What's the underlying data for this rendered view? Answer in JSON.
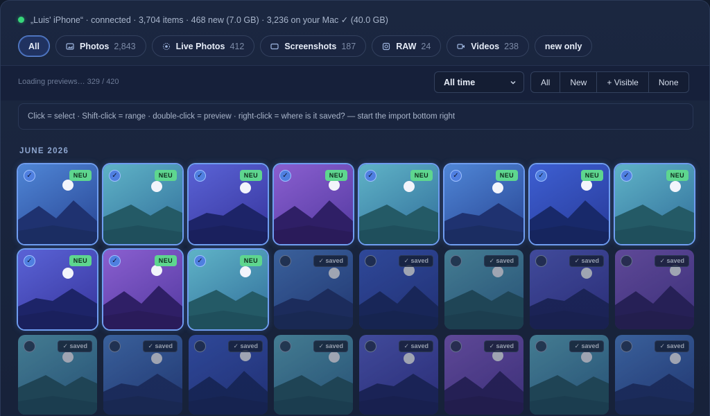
{
  "status": {
    "text": "„Luis' iPhone“ · connected · 3,704 items · 468 new (7.0 GB) · 3,236 on your Mac ✓ (40.0 GB)",
    "connected_color": "#37d67a"
  },
  "filters": [
    {
      "label": "All",
      "count": "",
      "icon": "",
      "active": true
    },
    {
      "label": "Photos",
      "count": "2,843",
      "icon": "photo-icon",
      "active": false
    },
    {
      "label": "Live Photos",
      "count": "412",
      "icon": "live-photo-icon",
      "active": false
    },
    {
      "label": "Screenshots",
      "count": "187",
      "icon": "screenshot-icon",
      "active": false
    },
    {
      "label": "RAW",
      "count": "24",
      "icon": "raw-icon",
      "active": false
    },
    {
      "label": "Videos",
      "count": "238",
      "icon": "video-icon",
      "active": false
    },
    {
      "label": "new only",
      "count": "",
      "icon": "",
      "active": false
    }
  ],
  "toolbar": {
    "loading": "Loading previews… 329 / 420",
    "time_range": "All time",
    "selection_buttons": [
      "All",
      "New",
      "+ Visible",
      "None"
    ]
  },
  "hint": "Click = select · Shift-click = range · double-click = preview · right-click = where is it saved? — start the import bottom right",
  "section": {
    "month": "JUNE 2026"
  },
  "badges": {
    "new": "NEU",
    "saved": "✓ saved",
    "check": "✓"
  },
  "colors": {
    "accent": "#6f9df0",
    "new_badge": "#5ed68f",
    "background": "#17223a"
  },
  "tiles": [
    {
      "state": "new",
      "selected": true,
      "palette": "blue"
    },
    {
      "state": "new",
      "selected": true,
      "palette": "teal"
    },
    {
      "state": "new",
      "selected": true,
      "palette": "indigo"
    },
    {
      "state": "new",
      "selected": true,
      "palette": "purple"
    },
    {
      "state": "new",
      "selected": true,
      "palette": "teal"
    },
    {
      "state": "new",
      "selected": true,
      "palette": "blue"
    },
    {
      "state": "new",
      "selected": true,
      "palette": "deepblue"
    },
    {
      "state": "new",
      "selected": true,
      "palette": "teal"
    },
    {
      "state": "new",
      "selected": true,
      "palette": "indigo"
    },
    {
      "state": "new",
      "selected": true,
      "palette": "purple"
    },
    {
      "state": "new",
      "selected": true,
      "palette": "teal"
    },
    {
      "state": "saved",
      "selected": false,
      "palette": "blue"
    },
    {
      "state": "saved",
      "selected": false,
      "palette": "deepblue"
    },
    {
      "state": "saved",
      "selected": false,
      "palette": "teal"
    },
    {
      "state": "saved",
      "selected": false,
      "palette": "indigo"
    },
    {
      "state": "saved",
      "selected": false,
      "palette": "purple"
    },
    {
      "state": "saved",
      "selected": false,
      "palette": "teal"
    },
    {
      "state": "saved",
      "selected": false,
      "palette": "blue"
    },
    {
      "state": "saved",
      "selected": false,
      "palette": "deepblue"
    },
    {
      "state": "saved",
      "selected": false,
      "palette": "teal"
    },
    {
      "state": "saved",
      "selected": false,
      "palette": "indigo"
    },
    {
      "state": "saved",
      "selected": false,
      "palette": "purple"
    },
    {
      "state": "saved",
      "selected": false,
      "palette": "teal"
    },
    {
      "state": "saved",
      "selected": false,
      "palette": "blue"
    }
  ]
}
